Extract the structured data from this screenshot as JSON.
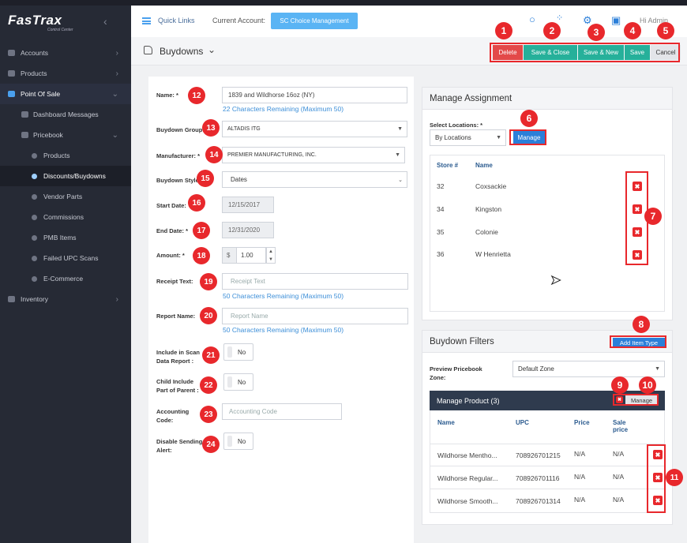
{
  "sidebar": {
    "logo": "FasTrax",
    "logo_sub": "Control Center",
    "items": [
      {
        "label": "Accounts",
        "level": 0,
        "chevron": "›"
      },
      {
        "label": "Products",
        "level": 0,
        "chevron": "›"
      },
      {
        "label": "Point Of Sale",
        "level": 0,
        "chevron": "⌄"
      },
      {
        "label": "Dashboard Messages",
        "level": 1,
        "chevron": ""
      },
      {
        "label": "Pricebook",
        "level": 1,
        "chevron": "⌄"
      },
      {
        "label": "Products",
        "level": 2,
        "chevron": ""
      },
      {
        "label": "Discounts/Buydowns",
        "level": 2,
        "chevron": ""
      },
      {
        "label": "Vendor Parts",
        "level": 2,
        "chevron": ""
      },
      {
        "label": "Commissions",
        "level": 2,
        "chevron": ""
      },
      {
        "label": "PMB Items",
        "level": 2,
        "chevron": ""
      },
      {
        "label": "Failed UPC Scans",
        "level": 2,
        "chevron": ""
      },
      {
        "label": "E-Commerce",
        "level": 2,
        "chevron": ""
      },
      {
        "label": "Inventory",
        "level": 0,
        "chevron": "›"
      }
    ]
  },
  "header": {
    "quick_links": "Quick Links",
    "current_account_label": "Current Account:",
    "current_account": "SC Choice Management",
    "admin": "Hi Admin"
  },
  "page": {
    "title": "Buydowns",
    "buttons": {
      "delete": "Delete",
      "save_close": "Save & Close",
      "save_new": "Save & New",
      "save": "Save",
      "cancel": "Cancel"
    }
  },
  "form": {
    "name_label": "Name: *",
    "name_value": "1839 and Wildhorse 16oz (NY)",
    "name_remaining": "22 Characters Remaining (Maximum 50)",
    "group_label": "Buydown Group:",
    "group_value": "ALTADIS ITG",
    "manufacturer_label": "Manufacturer: *",
    "manufacturer_value": "PREMIER MANUFACTURING, INC.",
    "style_label": "Buydown Style:",
    "style_value": "Dates",
    "start_label": "Start Date:",
    "start_value": "12/15/2017",
    "end_label": "End Date: *",
    "end_value": "12/31/2020",
    "amount_label": "Amount: *",
    "amount_prefix": "$",
    "amount_value": "1.00",
    "receipt_label": "Receipt Text:",
    "receipt_placeholder": "Receipt Text",
    "receipt_remaining": "50 Characters Remaining (Maximum 50)",
    "report_label": "Report Name:",
    "report_placeholder": "Report Name",
    "report_remaining": "50 Characters Remaining (Maximum 50)",
    "include_label_1": "Include in Scan",
    "include_label_2": "Data Report :",
    "include_value": "No",
    "child_label_1": "Child Include",
    "child_label_2": "Part of Parent :",
    "child_value": "No",
    "acct_label_1": "Accounting",
    "acct_label_2": "Code:",
    "acct_placeholder": "Accounting Code",
    "disable_label_1": "Disable Sending",
    "disable_label_2": "Alert:",
    "disable_value": "No"
  },
  "assignment": {
    "title": "Manage Assignment",
    "select_label": "Select Locations: *",
    "select_value": "By Locations",
    "manage": "Manage",
    "col_store": "Store #",
    "col_name": "Name",
    "rows": [
      {
        "store": "32",
        "name": "Coxsackie"
      },
      {
        "store": "34",
        "name": "Kingston"
      },
      {
        "store": "35",
        "name": "Colonie"
      },
      {
        "store": "36",
        "name": "W Henrietta"
      }
    ]
  },
  "filters": {
    "title": "Buydown Filters",
    "add_item_type": "Add Item Type",
    "preview_label_1": "Preview Pricebook",
    "preview_label_2": "Zone:",
    "preview_value": "Default Zone",
    "product_header": "Manage Product (3)",
    "manage": "Manage",
    "col_name": "Name",
    "col_upc": "UPC",
    "col_price": "Price",
    "col_sale_1": "Sale",
    "col_sale_2": "price",
    "rows": [
      {
        "name": "Wildhorse Mentho...",
        "upc": "708926701215",
        "price": "N/A",
        "sale": "N/A"
      },
      {
        "name": "Wildhorse Regular...",
        "upc": "708926701116",
        "price": "N/A",
        "sale": "N/A"
      },
      {
        "name": "Wildhorse Smooth...",
        "upc": "708926701314",
        "price": "N/A",
        "sale": "N/A"
      }
    ]
  },
  "badges": [
    "1",
    "2",
    "3",
    "4",
    "5",
    "6",
    "7",
    "8",
    "9",
    "10",
    "11",
    "12",
    "13",
    "14",
    "15",
    "16",
    "17",
    "18",
    "19",
    "20",
    "21",
    "22",
    "23",
    "24"
  ],
  "colors": {
    "accent": "#4aa0ee",
    "annotation": "#e8282c",
    "delete": "#e34949",
    "save": "#26b09a",
    "sidebar": "#262a35"
  }
}
